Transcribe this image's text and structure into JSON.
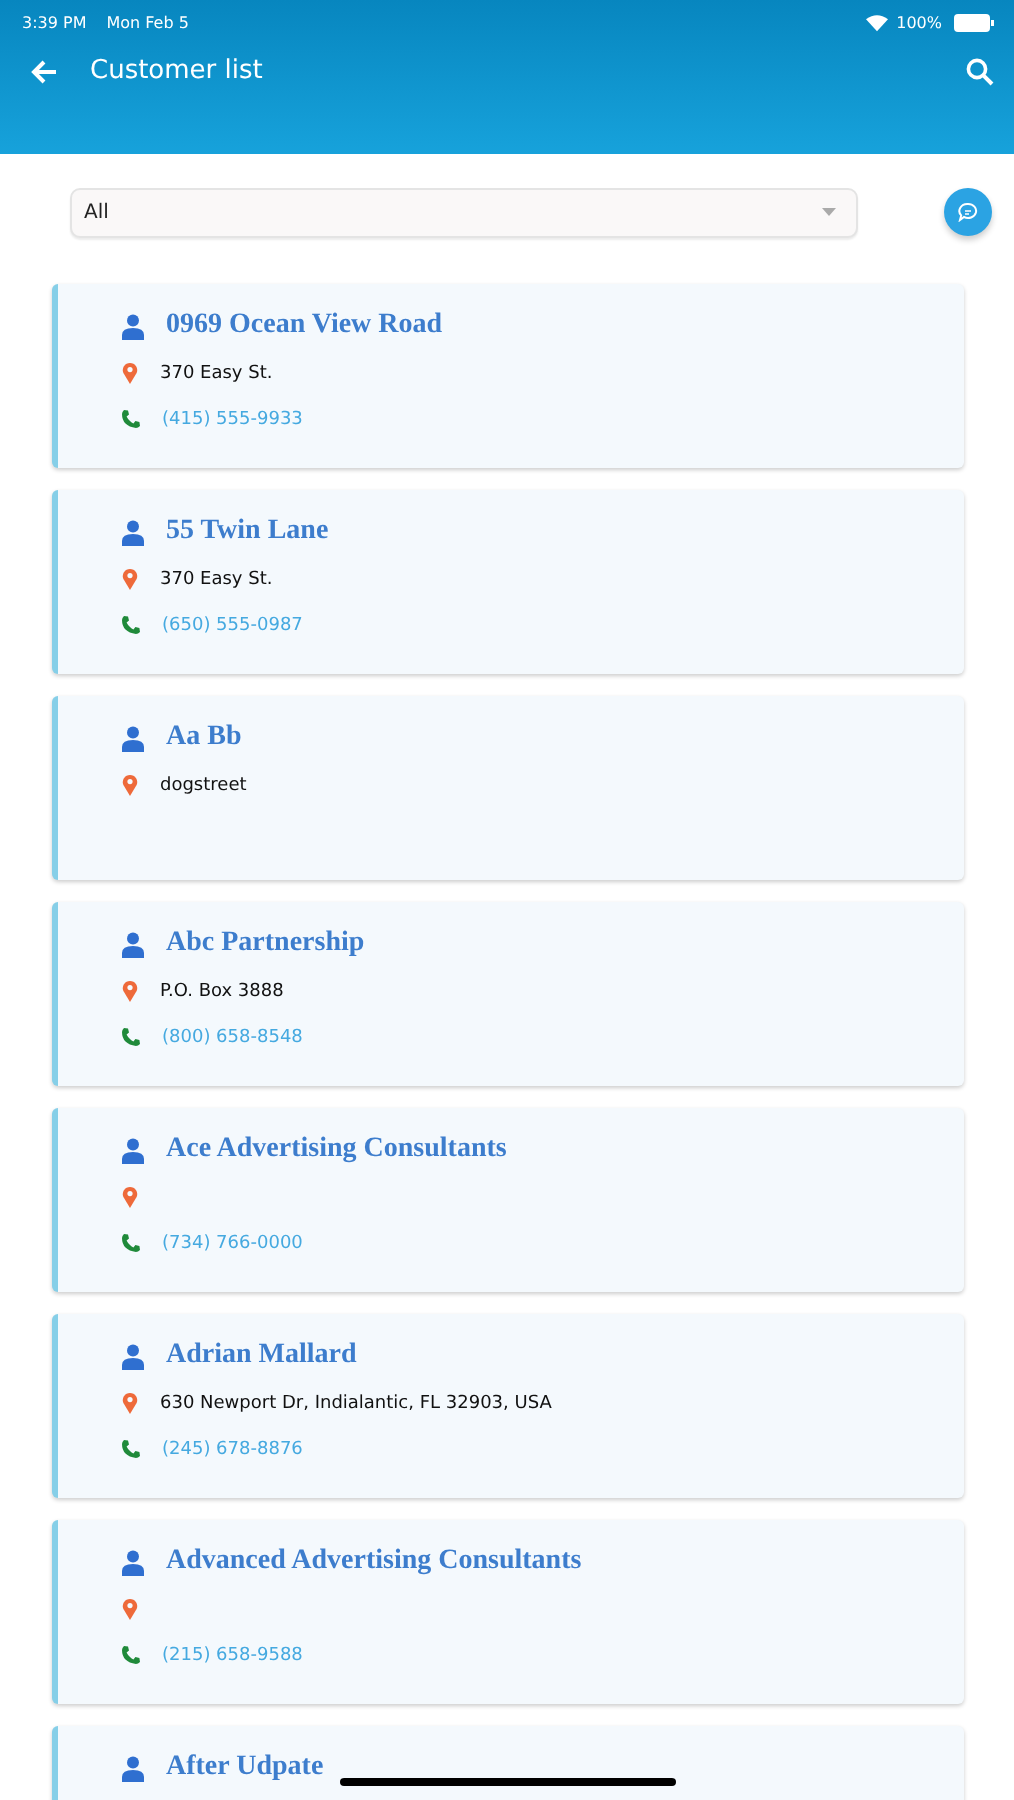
{
  "status_bar": {
    "time": "3:39 PM",
    "date": "Mon Feb 5",
    "battery": "100%"
  },
  "header": {
    "title": "Customer list"
  },
  "filter": {
    "value": "All"
  },
  "customers": [
    {
      "name": "0969 Ocean View Road",
      "address": "370 Easy St.",
      "phone": "(415) 555-9933"
    },
    {
      "name": "55 Twin Lane",
      "address": "370 Easy St.",
      "phone": "(650) 555-0987"
    },
    {
      "name": "Aa Bb",
      "address": "dogstreet"
    },
    {
      "name": "Abc Partnership",
      "address": "P.O. Box 3888",
      "phone": "(800) 658-8548"
    },
    {
      "name": "Ace Advertising Consultants",
      "phone": "(734) 766-0000"
    },
    {
      "name": "Adrian Mallard",
      "address": "630 Newport Dr, Indialantic, FL 32903, USA",
      "phone": "(245) 678-8876"
    },
    {
      "name": "Advanced Advertising Consultants",
      "phone": "(215) 658-9588"
    },
    {
      "name": "After Udpate"
    }
  ]
}
